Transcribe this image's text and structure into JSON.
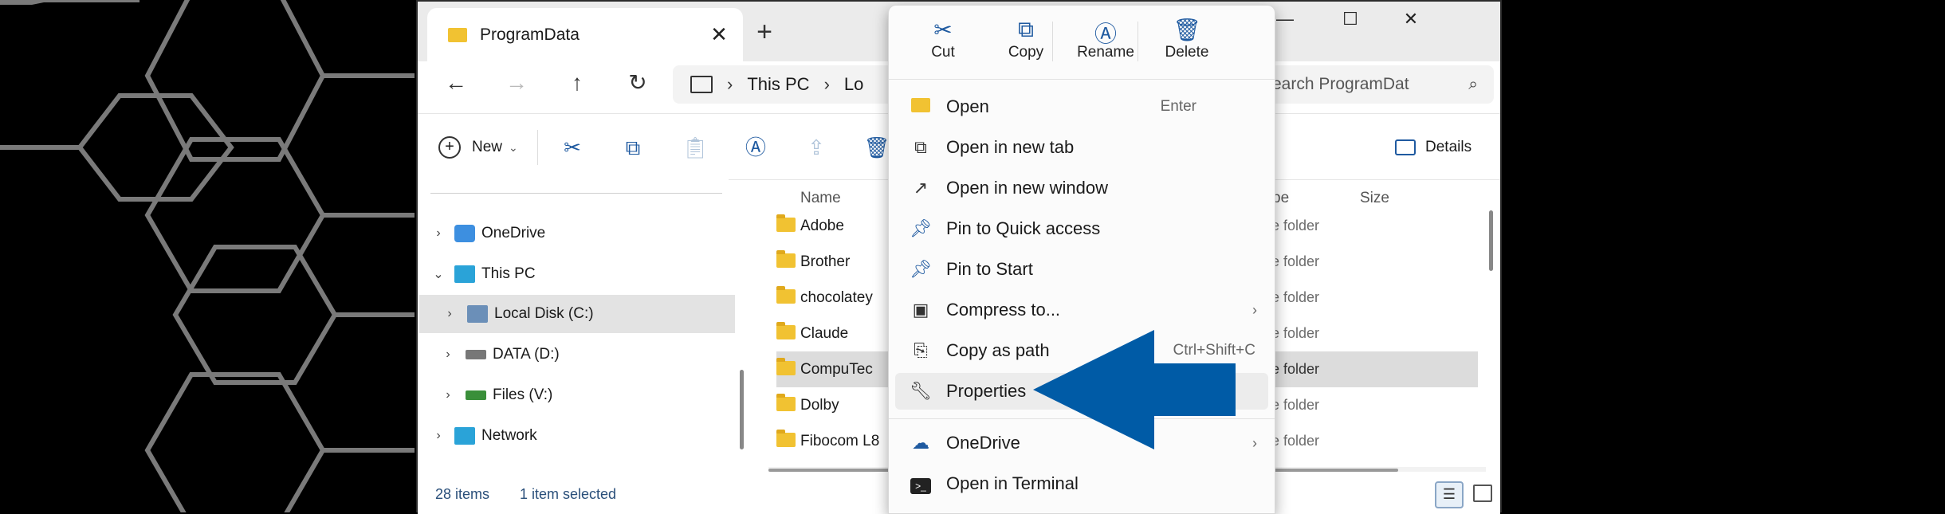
{
  "window": {
    "tab_title": "ProgramData",
    "address": [
      "This PC",
      "Lo"
    ],
    "search_placeholder": "Search ProgramDat"
  },
  "toolbar": {
    "new_label": "New",
    "details_label": "Details"
  },
  "sidebar": {
    "items": [
      {
        "label": "OneDrive"
      },
      {
        "label": "This PC"
      },
      {
        "label": "Local Disk (C:)"
      },
      {
        "label": "DATA (D:)"
      },
      {
        "label": "Files (V:)"
      },
      {
        "label": "Network"
      }
    ]
  },
  "content": {
    "col_name": "Name",
    "col_type": "Type",
    "col_size": "Size",
    "rows": [
      {
        "name": "Adobe",
        "type": "File folder"
      },
      {
        "name": "Brother",
        "type": "File folder"
      },
      {
        "name": "chocolatey",
        "type": "File folder"
      },
      {
        "name": "Claude",
        "type": "File folder"
      },
      {
        "name": "CompuTec",
        "type": "File folder"
      },
      {
        "name": "Dolby",
        "type": "File folder"
      },
      {
        "name": "Fibocom L8",
        "type": "File folder"
      }
    ]
  },
  "status": {
    "count": "28 items",
    "selection": "1 item selected"
  },
  "menu": {
    "quick": [
      {
        "label": "Cut",
        "icon": "scissors-icon"
      },
      {
        "label": "Copy",
        "icon": "copy-icon"
      },
      {
        "label": "Rename",
        "icon": "rename-icon"
      },
      {
        "label": "Delete",
        "icon": "trash-icon"
      }
    ],
    "items": [
      {
        "label": "Open",
        "shortcut": "Enter"
      },
      {
        "label": "Open in new tab",
        "shortcut": ""
      },
      {
        "label": "Open in new window",
        "shortcut": ""
      },
      {
        "label": "Pin to Quick access",
        "shortcut": ""
      },
      {
        "label": "Pin to Start",
        "shortcut": ""
      },
      {
        "label": "Compress to...",
        "shortcut": ""
      },
      {
        "label": "Copy as path",
        "shortcut": "Ctrl+Shift+C"
      },
      {
        "label": "Properties",
        "shortcut": ""
      },
      {
        "label": "OneDrive",
        "shortcut": ""
      },
      {
        "label": "Open in Terminal",
        "shortcut": ""
      }
    ]
  },
  "colors": {
    "accent": "#1f5aa0",
    "arrow": "#005ba6",
    "folder": "#f1c232"
  }
}
